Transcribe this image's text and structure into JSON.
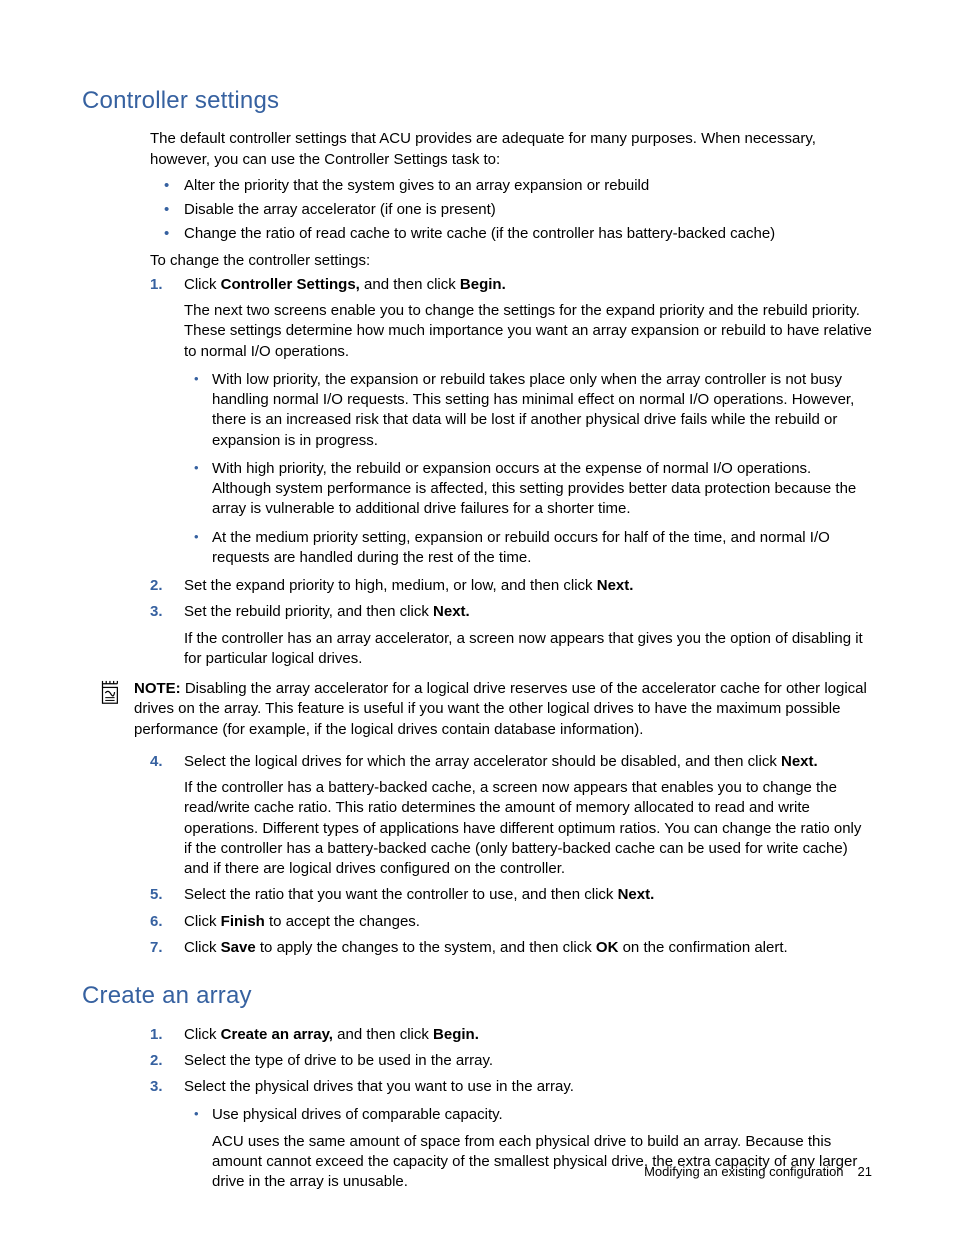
{
  "section1": {
    "heading": "Controller settings",
    "intro": "The default controller settings that ACU provides are adequate for many purposes. When necessary, however, you can use the Controller Settings task to:",
    "bullets": [
      "Alter the priority that the system gives to an array expansion or rebuild",
      "Disable the array accelerator (if one is present)",
      "Change the ratio of read cache to write cache (if the controller has battery-backed cache)"
    ],
    "lead": "To change the controller settings:",
    "step1_pre": "Click ",
    "step1_b1": "Controller Settings,",
    "step1_mid": " and then click ",
    "step1_b2": "Begin.",
    "step1_followup": "The next two screens enable you to change the settings for the expand priority and the rebuild priority. These settings determine how much importance you want an array expansion or rebuild to have relative to normal I/O operations.",
    "step1_subs": [
      "With low priority, the expansion or rebuild takes place only when the array controller is not busy handling normal I/O requests. This setting has minimal effect on normal I/O operations. However, there is an increased risk that data will be lost if another physical drive fails while the rebuild or expansion is in progress.",
      "With high priority, the rebuild or expansion occurs at the expense of normal I/O operations. Although system performance is affected, this setting provides better data protection because the array is vulnerable to additional drive failures for a shorter time.",
      "At the medium priority setting, expansion or rebuild occurs for half of the time, and normal I/O requests are handled during the rest of the time."
    ],
    "step2_pre": "Set the expand priority to high, medium, or low, and then click ",
    "step2_b": "Next.",
    "step3_pre": "Set the rebuild priority, and then click ",
    "step3_b": "Next.",
    "step3_followup": "If the controller has an array accelerator, a screen now appears that gives you the option of disabling it for particular logical drives.",
    "note_label": "NOTE:",
    "note_text": "  Disabling the array accelerator for a logical drive reserves use of the accelerator cache for other logical drives on the array. This feature is useful if you want the other logical drives to have the maximum possible performance (for example, if the logical drives contain database information).",
    "step4_pre": "Select the logical drives for which the array accelerator should be disabled, and then click ",
    "step4_b": "Next.",
    "step4_followup": "If the controller has a battery-backed cache, a screen now appears that enables you to change the read/write cache ratio. This ratio determines the amount of memory allocated to read and write operations. Different types of applications have different optimum ratios. You can change the ratio only if the controller has a battery-backed cache (only battery-backed cache can be used for write cache) and if there are logical drives configured on the controller.",
    "step5_pre": "Select the ratio that you want the controller to use, and then click ",
    "step5_b": "Next.",
    "step6_pre": "Click ",
    "step6_b": "Finish",
    "step6_post": " to accept the changes.",
    "step7_pre": "Click ",
    "step7_b1": "Save",
    "step7_mid": " to apply the changes to the system, and then click ",
    "step7_b2": "OK",
    "step7_post": " on the confirmation alert."
  },
  "section2": {
    "heading": "Create an array",
    "step1_pre": "Click ",
    "step1_b1": "Create an array,",
    "step1_mid": " and then click ",
    "step1_b2": "Begin.",
    "step2": "Select the type of drive to be used in the array.",
    "step3": "Select the physical drives that you want to use in the array.",
    "step3_sub": "Use physical drives of comparable capacity.",
    "step3_sub_followup": "ACU uses the same amount of space from each physical drive to build an array. Because this amount cannot exceed the capacity of the smallest physical drive, the extra capacity of any larger drive in the array is unusable."
  },
  "footer": {
    "title": "Modifying an existing configuration",
    "page": "21"
  }
}
